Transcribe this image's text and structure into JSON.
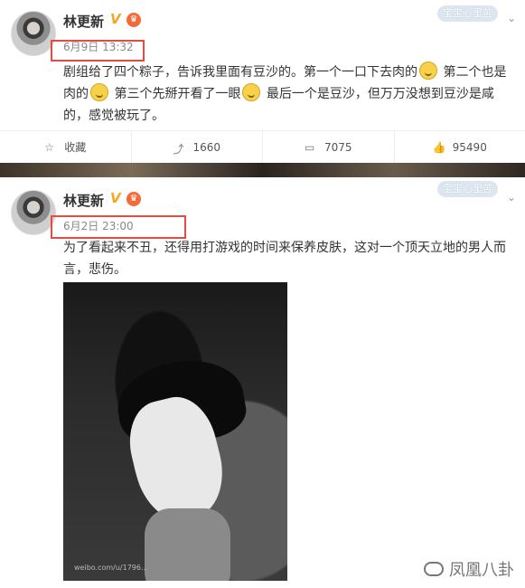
{
  "posts": [
    {
      "username": "林更新",
      "tag": "宝宝心里苦",
      "time": "6月9日 13:32",
      "content_parts": [
        "剧组给了四个粽子，告诉我里面有豆沙的。第一个一口下去肉的",
        " 第二个也是肉的",
        " 第三个先掰开看了一眼",
        "  最后一个是豆沙，但万万没想到豆沙是咸的，感觉被玩了。"
      ],
      "actions": {
        "favorite": "收藏",
        "repost": "1660",
        "comment": "7075",
        "like": "95490"
      }
    },
    {
      "username": "林更新",
      "tag": "宝宝心里苦",
      "time": "6月2日 23:00",
      "content": "为了看起来不丑，还得用打游戏的时间来保养皮肤，这对一个顶天立地的男人而言，悲伤。",
      "photo_watermark": "weibo.com/u/1796..."
    }
  ],
  "brand": "凤凰八卦",
  "icons": {
    "verified": "V",
    "crown": "♛",
    "chevron": "⌄",
    "favorite": "☆",
    "repost": "⤴",
    "comment": "▭",
    "like": "👍"
  }
}
